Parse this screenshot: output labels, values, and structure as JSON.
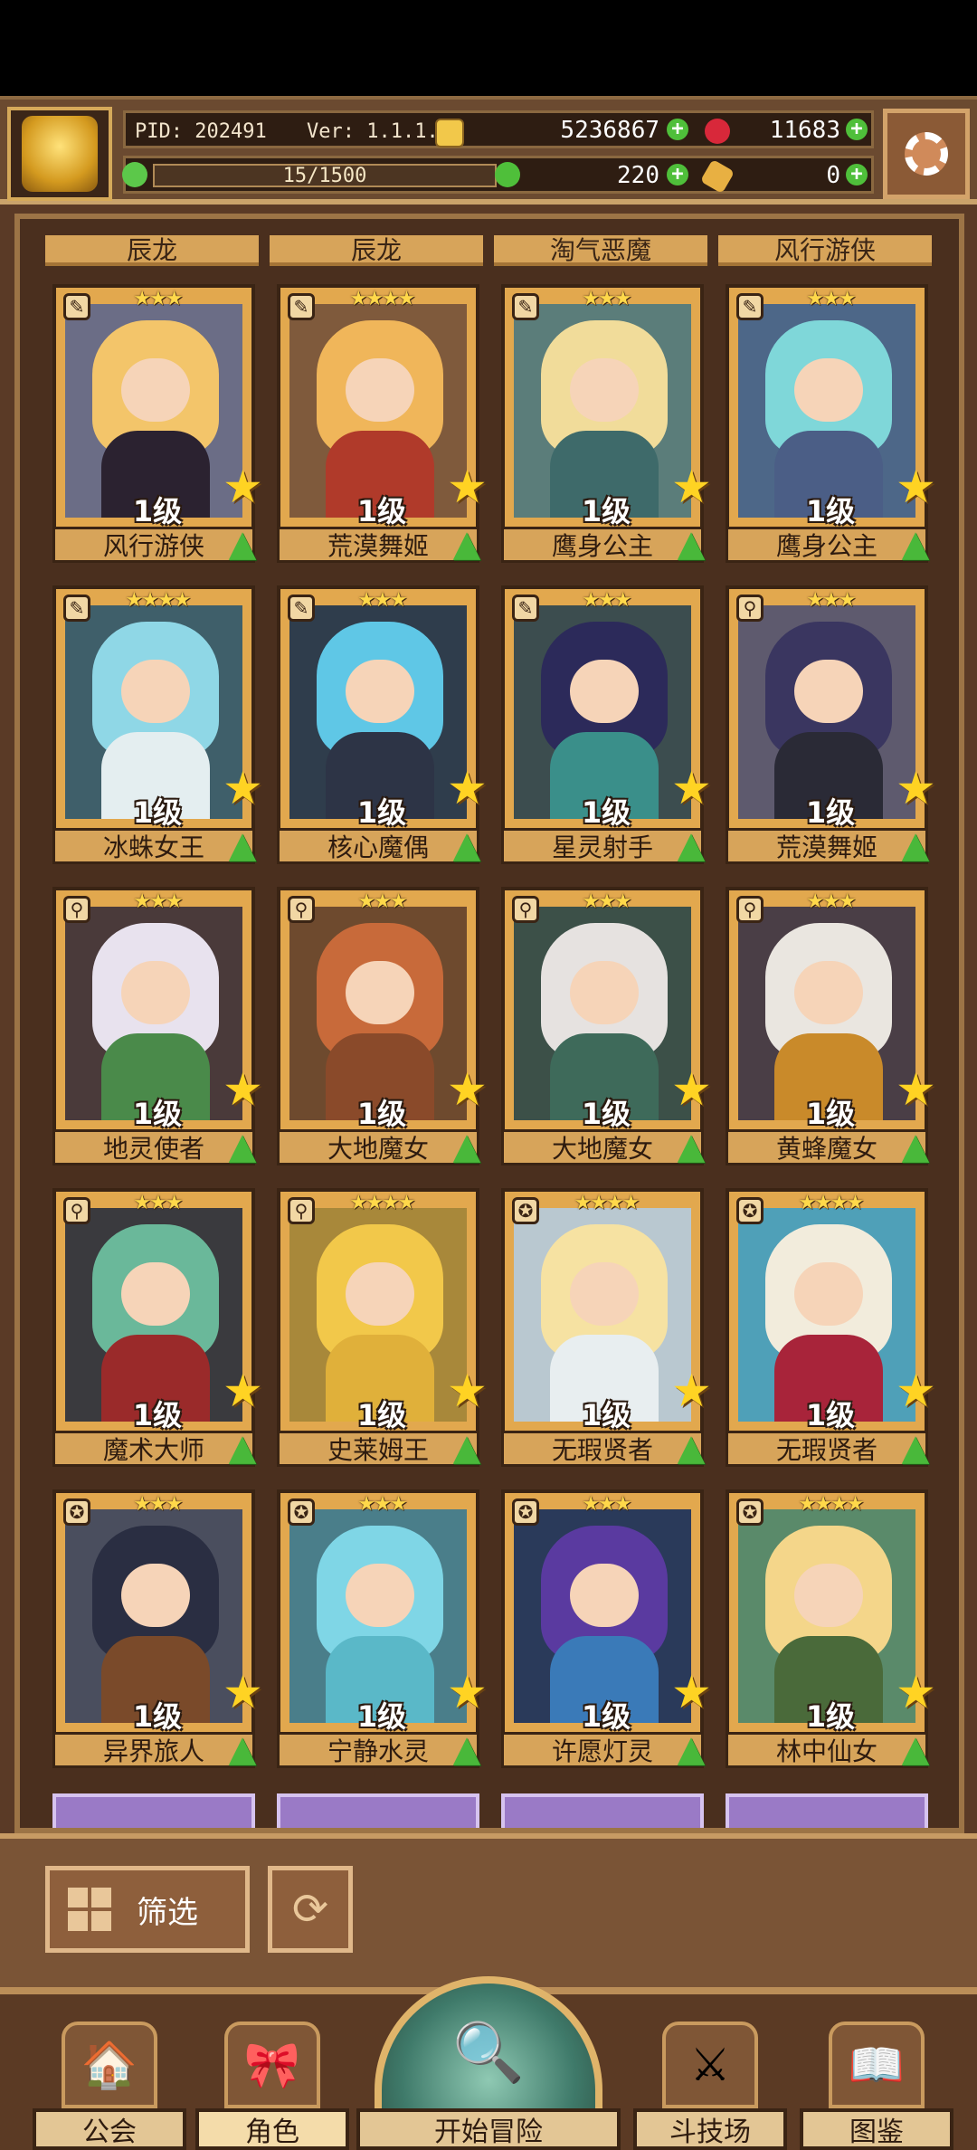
{
  "hud": {
    "pid": "PID: 202491",
    "version": "Ver: 1.1.1.5",
    "gold": "5236867",
    "gems": "11683",
    "exp": "15/1500",
    "clover": "220",
    "tickets": "0"
  },
  "top_partial_names": [
    "辰龙",
    "辰龙",
    "淘气恶魔",
    "风行游侠"
  ],
  "heroes": [
    {
      "stars": "★★★",
      "level": "1级",
      "name": "风行游侠",
      "hair": "#f3c56a",
      "body": "#2b2230",
      "bg": "#6b6d86",
      "cls": "✎"
    },
    {
      "stars": "★★★★",
      "level": "1级",
      "name": "荒漠舞姬",
      "hair": "#f0b65a",
      "body": "#b03a2a",
      "bg": "#7f5a3c",
      "cls": "✎"
    },
    {
      "stars": "★★★",
      "level": "1级",
      "name": "鹰身公主",
      "hair": "#f1dc9a",
      "body": "#3e6a6a",
      "bg": "#5b7d7a",
      "cls": "✎"
    },
    {
      "stars": "★★★",
      "level": "1级",
      "name": "鹰身公主",
      "hair": "#7fd7d9",
      "body": "#4b5e86",
      "bg": "#4d6788",
      "cls": "✎"
    },
    {
      "stars": "★★★★",
      "level": "1级",
      "name": "冰蛛女王",
      "hair": "#8fd7e6",
      "body": "#e4eef0",
      "bg": "#3f5f6a",
      "cls": "✎"
    },
    {
      "stars": "★★★",
      "level": "1级",
      "name": "核心魔偶",
      "hair": "#5fc7e6",
      "body": "#2d3446",
      "bg": "#2f3d4c",
      "cls": "✎"
    },
    {
      "stars": "★★★",
      "level": "1级",
      "name": "星灵射手",
      "hair": "#2c2a5a",
      "body": "#3a8f8a",
      "bg": "#3c4d4f",
      "cls": "✎"
    },
    {
      "stars": "★★★",
      "level": "1级",
      "name": "荒漠舞姬",
      "hair": "#3a3660",
      "body": "#2a2a36",
      "bg": "#5e5a6e",
      "cls": "⚲"
    },
    {
      "stars": "★★★",
      "level": "1级",
      "name": "地灵使者",
      "hair": "#e8e2ee",
      "body": "#4a8a4a",
      "bg": "#4a3a3a",
      "cls": "⚲"
    },
    {
      "stars": "★★★",
      "level": "1级",
      "name": "大地魔女",
      "hair": "#c86a3a",
      "body": "#8a4a2a",
      "bg": "#6e4a2e",
      "cls": "⚲"
    },
    {
      "stars": "★★★",
      "level": "1级",
      "name": "大地魔女",
      "hair": "#e6e2e0",
      "body": "#3e6a5a",
      "bg": "#3c5048",
      "cls": "⚲"
    },
    {
      "stars": "★★★",
      "level": "1级",
      "name": "黄蜂魔女",
      "hair": "#eae6e0",
      "body": "#c98a2a",
      "bg": "#4a3e46",
      "cls": "⚲"
    },
    {
      "stars": "★★★",
      "level": "1级",
      "name": "魔术大师",
      "hair": "#6ab89a",
      "body": "#9a2a2a",
      "bg": "#3a3a3e",
      "cls": "⚲"
    },
    {
      "stars": "★★★★",
      "level": "1级",
      "name": "史莱姆王",
      "hair": "#f2c84a",
      "body": "#e0b03a",
      "bg": "#a8883a",
      "cls": "⚲"
    },
    {
      "stars": "★★★★",
      "level": "1级",
      "name": "无瑕贤者",
      "hair": "#f6e2a2",
      "body": "#e8eef0",
      "bg": "#b9c8d0",
      "cls": "✪"
    },
    {
      "stars": "★★★★",
      "level": "1级",
      "name": "无瑕贤者",
      "hair": "#f2ecdc",
      "body": "#a8243a",
      "bg": "#4fa0b8",
      "cls": "✪"
    },
    {
      "stars": "★★★",
      "level": "1级",
      "name": "异界旅人",
      "hair": "#2a2e42",
      "body": "#7a4a2a",
      "bg": "#4a4e5e",
      "cls": "✪"
    },
    {
      "stars": "★★★",
      "level": "1级",
      "name": "宁静水灵",
      "hair": "#7fd6e6",
      "body": "#5ab8c8",
      "bg": "#4a7e8a",
      "cls": "✪"
    },
    {
      "stars": "★★★",
      "level": "1级",
      "name": "许愿灯灵",
      "hair": "#5a3aa0",
      "body": "#3a7ab8",
      "bg": "#2a3a5a",
      "cls": "✪"
    },
    {
      "stars": "★★★★",
      "level": "1级",
      "name": "林中仙女",
      "hair": "#f4d68a",
      "body": "#4a6a3a",
      "bg": "#5a8a6a",
      "cls": "✪"
    }
  ],
  "filter": {
    "label": "筛选"
  },
  "nav": {
    "guild": "公会",
    "role": "角色",
    "adventure": "开始冒险",
    "arena": "斗技场",
    "codex": "图鉴"
  },
  "colors": {
    "accent_gold": "#d7a45a",
    "plus_green": "#4fbf3a",
    "frame_brown": "#3a2414"
  }
}
